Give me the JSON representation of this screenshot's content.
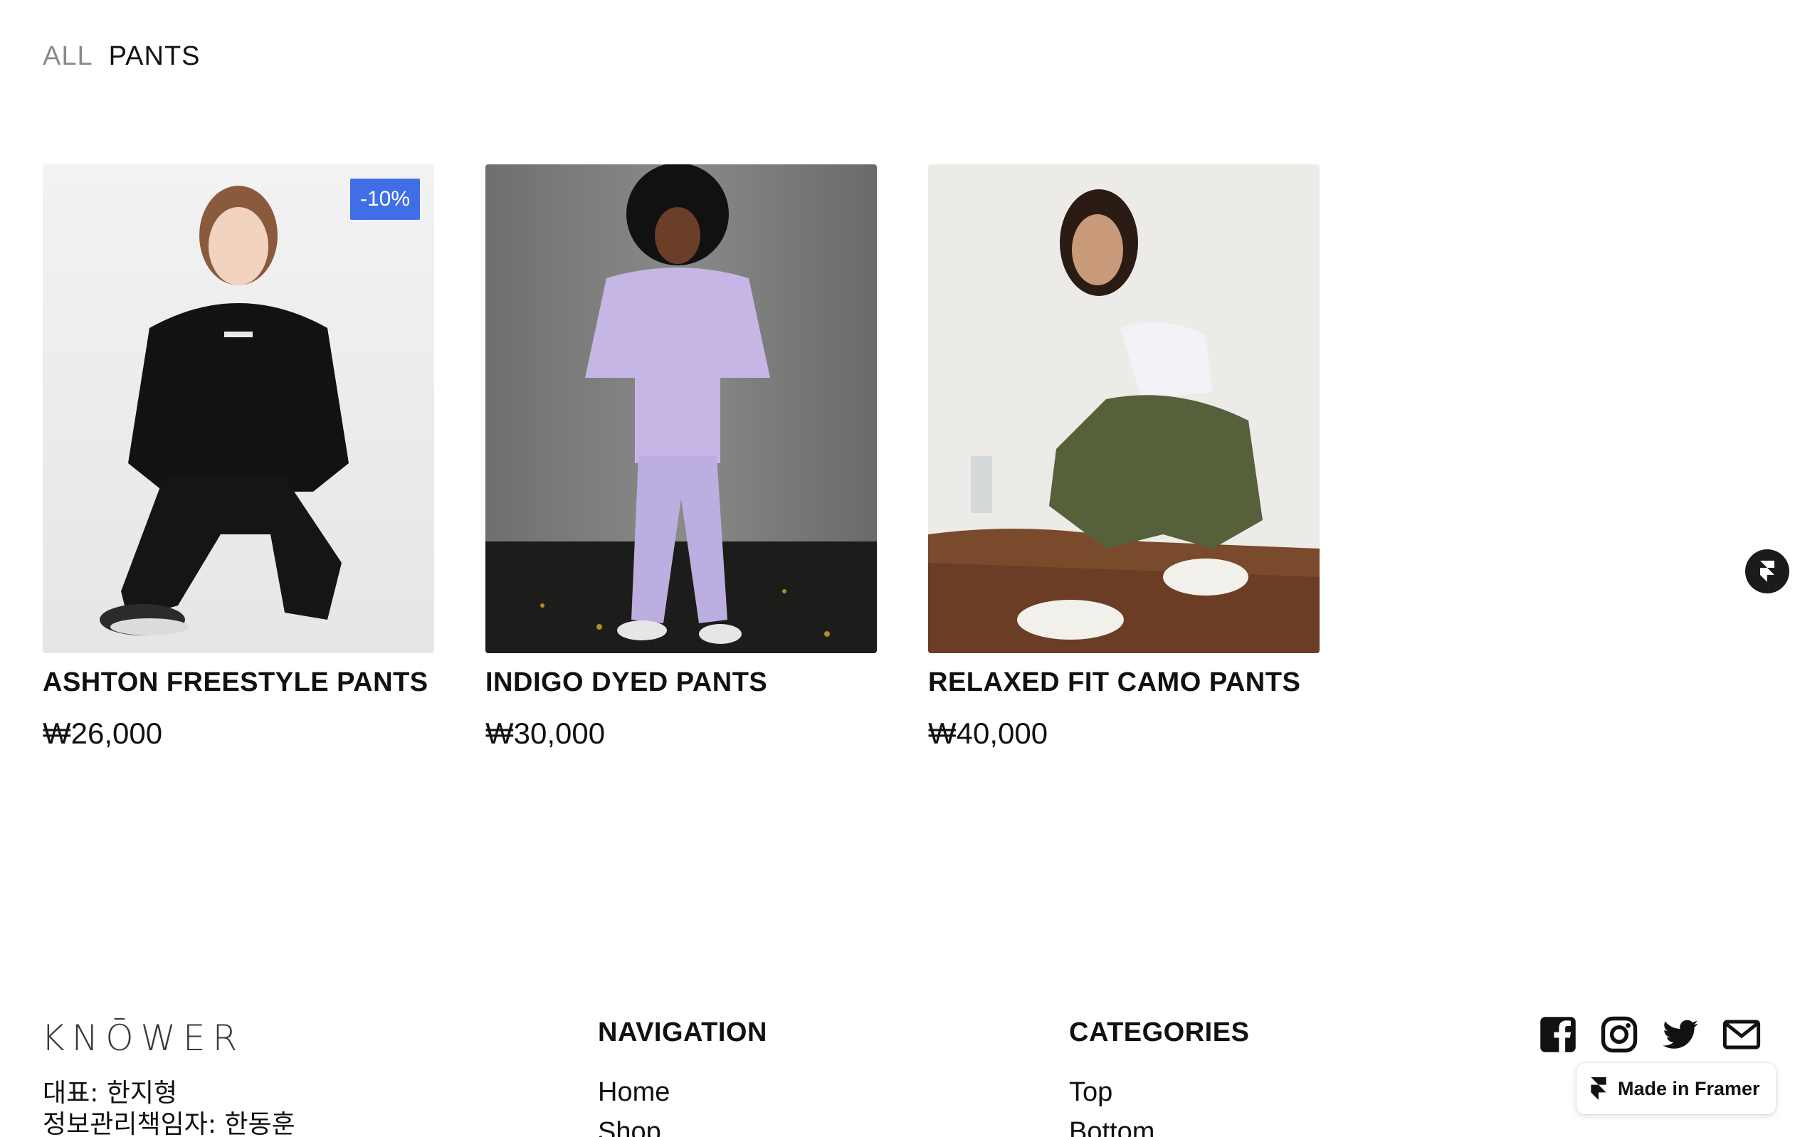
{
  "breadcrumb": {
    "all": "ALL",
    "current": "PANTS"
  },
  "products": [
    {
      "name": "ASHTON FREESTYLE PANTS",
      "price": "₩26,000",
      "badge": "-10%"
    },
    {
      "name": "INDIGO DYED PANTS",
      "price": "₩30,000"
    },
    {
      "name": "RELAXED FIT CAMO PANTS",
      "price": "₩40,000"
    }
  ],
  "footer": {
    "logo": "KNŌWER",
    "info": [
      "대표: 한지형",
      "정보관리책임자: 한동훈"
    ],
    "navigation": {
      "title": "NAVIGATION",
      "links": [
        "Home",
        "Shop"
      ]
    },
    "categories": {
      "title": "CATEGORIES",
      "links": [
        "Top",
        "Bottom"
      ]
    },
    "socials": [
      "facebook-icon",
      "instagram-icon",
      "twitter-icon",
      "mail-icon"
    ]
  },
  "made_in_framer": "Made in Framer",
  "colors": {
    "badge": "#3f6ee6",
    "text": "#111111",
    "muted": "#8a8a8a"
  }
}
